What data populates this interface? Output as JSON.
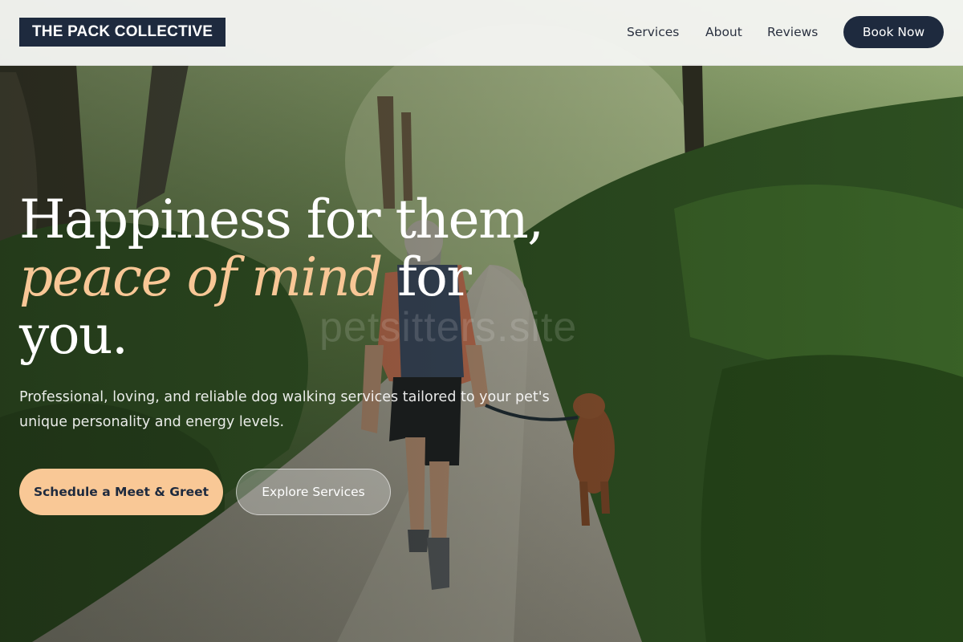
{
  "header": {
    "logo": "THE PACK COLLECTIVE",
    "nav": {
      "services": "Services",
      "about": "About",
      "reviews": "Reviews"
    },
    "cta": "Book Now"
  },
  "hero": {
    "headline_line1": "Happiness for them,",
    "headline_accent": "peace of mind",
    "headline_line2_rest": " for",
    "headline_line3": "you.",
    "subtext": "Professional, loving, and reliable dog walking services tailored to your pet's unique personality and energy levels.",
    "primary_button": "Schedule a Meet & Greet",
    "secondary_button": "Explore Services",
    "watermark": "petsitters.site"
  },
  "colors": {
    "navy": "#1e2a3e",
    "accent_peach": "#f8c796",
    "header_bg": "#f7f8f6"
  }
}
